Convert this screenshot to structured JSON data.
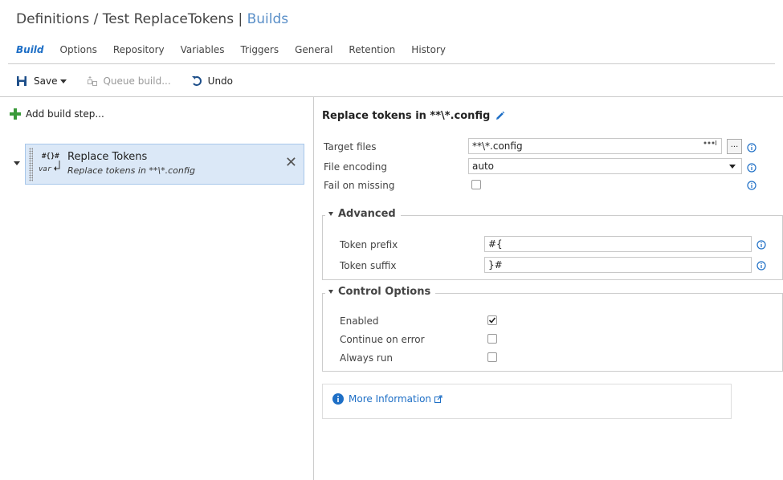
{
  "header": {
    "title_prefix": "Definitions / Test ReplaceTokens",
    "separator": "|",
    "title_link": "Builds"
  },
  "tabs": [
    {
      "label": "Build",
      "active": true
    },
    {
      "label": "Options"
    },
    {
      "label": "Repository"
    },
    {
      "label": "Variables"
    },
    {
      "label": "Triggers"
    },
    {
      "label": "General"
    },
    {
      "label": "Retention"
    },
    {
      "label": "History"
    }
  ],
  "toolbar": {
    "save_label": "Save",
    "queue_label": "Queue build...",
    "undo_label": "Undo"
  },
  "left": {
    "add_step_label": "Add build step...",
    "step": {
      "icon_top": "#{}#",
      "icon_bottom": "var",
      "name": "Replace Tokens",
      "description": "Replace tokens in **\\*.config",
      "close_glyph": "✕"
    }
  },
  "detail": {
    "title": "Replace tokens in **\\*.config",
    "target_files": {
      "label": "Target files",
      "value": "**\\*.config",
      "ellipsis": "..."
    },
    "file_encoding": {
      "label": "File encoding",
      "value": "auto"
    },
    "fail_on_missing": {
      "label": "Fail on missing",
      "checked": false
    },
    "advanced": {
      "legend": "Advanced",
      "token_prefix": {
        "label": "Token prefix",
        "value": "#{"
      },
      "token_suffix": {
        "label": "Token suffix",
        "value": "}#"
      }
    },
    "control_options": {
      "legend": "Control Options",
      "enabled": {
        "label": "Enabled",
        "checked": true
      },
      "continue_on_error": {
        "label": "Continue on error",
        "checked": false
      },
      "always_run": {
        "label": "Always run",
        "checked": false
      }
    },
    "more_info": {
      "label": "More Information"
    }
  },
  "colors": {
    "accent": "#1e6fc6",
    "link": "#5a8fc8",
    "step_bg": "#dbe8f7",
    "add_green": "#3a9a3a"
  }
}
